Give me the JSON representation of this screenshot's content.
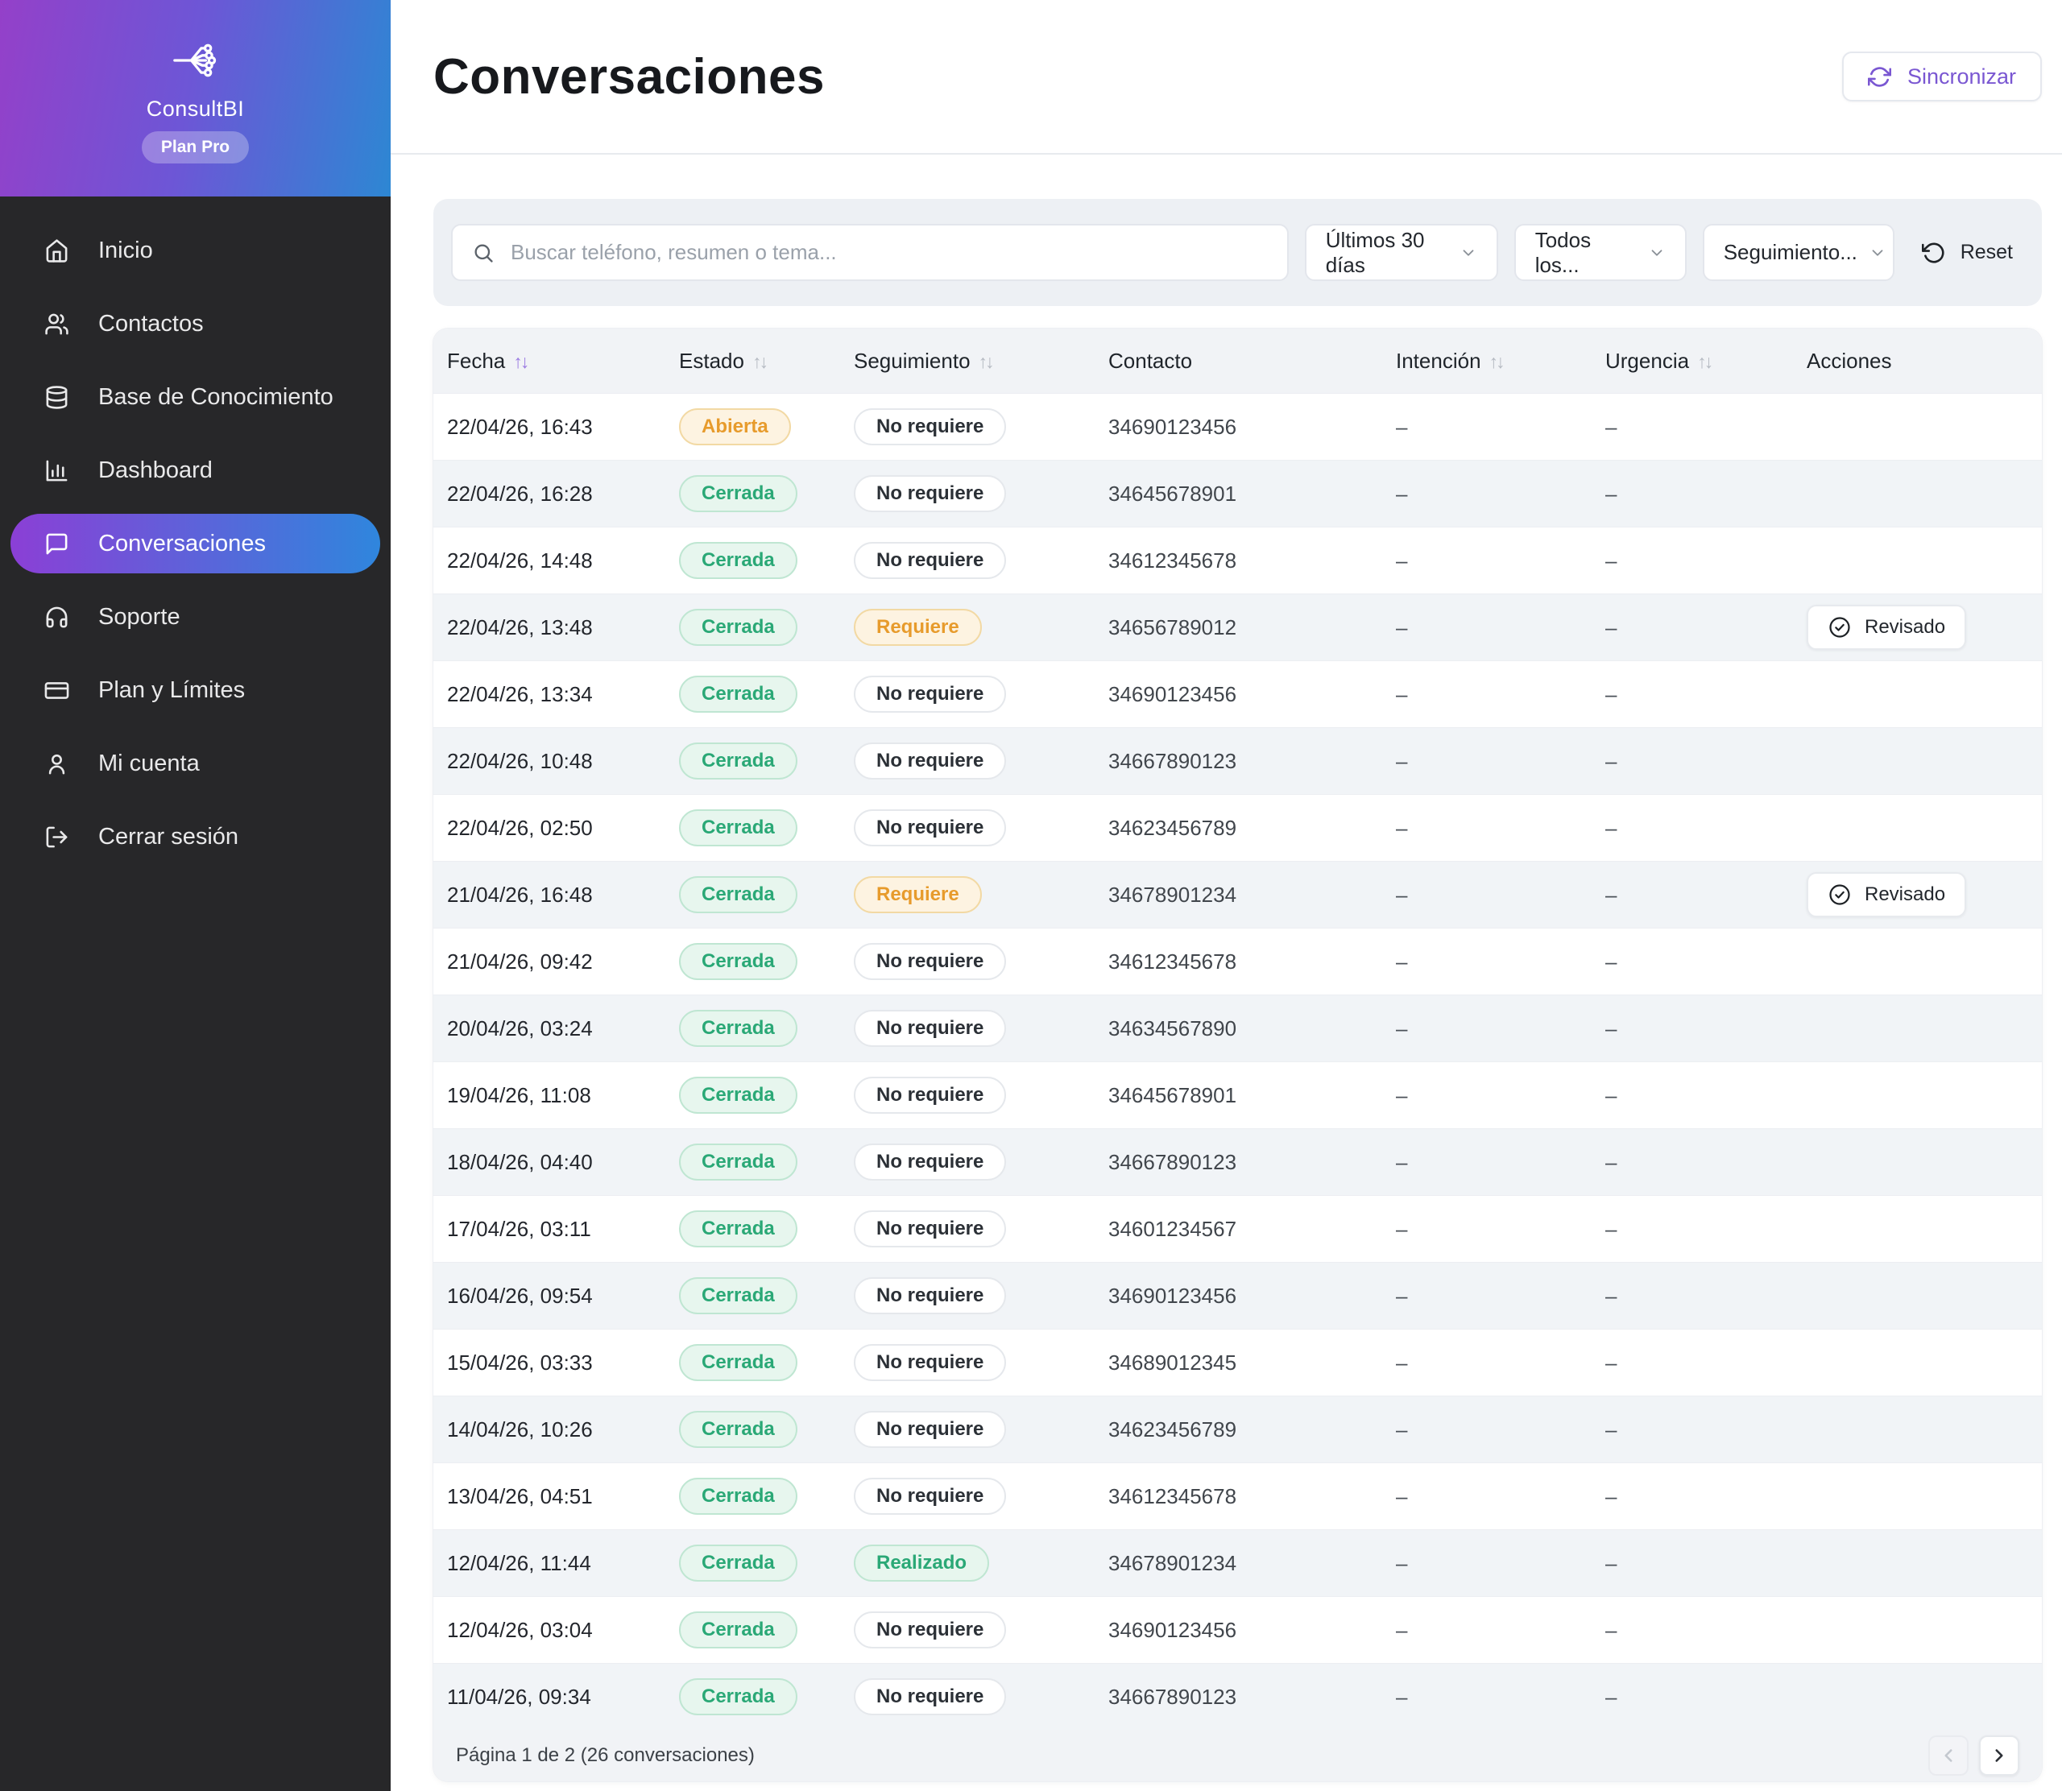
{
  "sidebar": {
    "brand": "ConsultBI",
    "plan_badge": "Plan Pro",
    "items": [
      {
        "label": "Inicio",
        "icon": "home",
        "active": false
      },
      {
        "label": "Contactos",
        "icon": "users",
        "active": false
      },
      {
        "label": "Base de Conocimiento",
        "icon": "database",
        "active": false
      },
      {
        "label": "Dashboard",
        "icon": "bar-chart",
        "active": false
      },
      {
        "label": "Conversaciones",
        "icon": "chat",
        "active": true
      },
      {
        "label": "Soporte",
        "icon": "headphones",
        "active": false
      },
      {
        "label": "Plan y Límites",
        "icon": "credit-card",
        "active": false
      },
      {
        "label": "Mi cuenta",
        "icon": "user",
        "active": false
      },
      {
        "label": "Cerrar sesión",
        "icon": "logout",
        "active": false
      }
    ]
  },
  "header": {
    "title": "Conversaciones",
    "sync_button": "Sincronizar"
  },
  "filters": {
    "search_placeholder": "Buscar teléfono, resumen o tema...",
    "date_filter": "Últimos 30 días",
    "status_filter": "Todos los...",
    "followup_filter": "Seguimiento...",
    "reset_label": "Reset"
  },
  "table": {
    "columns": [
      {
        "label": "Fecha",
        "sortable": true,
        "sort_active": true
      },
      {
        "label": "Estado",
        "sortable": true,
        "sort_active": false
      },
      {
        "label": "Seguimiento",
        "sortable": true,
        "sort_active": false
      },
      {
        "label": "Contacto",
        "sortable": false,
        "sort_active": false
      },
      {
        "label": "Intención",
        "sortable": true,
        "sort_active": false
      },
      {
        "label": "Urgencia",
        "sortable": true,
        "sort_active": false
      },
      {
        "label": "Acciones",
        "sortable": false,
        "sort_active": false
      }
    ],
    "badge_variants": {
      "Abierta": "warn",
      "Cerrada": "success",
      "Requiere": "warn",
      "No requiere": "neutral",
      "Realizado": "success"
    },
    "action_label": "Revisado",
    "empty_value": "–",
    "rows": [
      {
        "fecha": "22/04/26, 16:43",
        "estado": "Abierta",
        "seguimiento": "No requiere",
        "contacto": "34690123456",
        "intencion": "–",
        "urgencia": "–",
        "action": false
      },
      {
        "fecha": "22/04/26, 16:28",
        "estado": "Cerrada",
        "seguimiento": "No requiere",
        "contacto": "34645678901",
        "intencion": "–",
        "urgencia": "–",
        "action": false
      },
      {
        "fecha": "22/04/26, 14:48",
        "estado": "Cerrada",
        "seguimiento": "No requiere",
        "contacto": "34612345678",
        "intencion": "–",
        "urgencia": "–",
        "action": false
      },
      {
        "fecha": "22/04/26, 13:48",
        "estado": "Cerrada",
        "seguimiento": "Requiere",
        "contacto": "34656789012",
        "intencion": "–",
        "urgencia": "–",
        "action": true
      },
      {
        "fecha": "22/04/26, 13:34",
        "estado": "Cerrada",
        "seguimiento": "No requiere",
        "contacto": "34690123456",
        "intencion": "–",
        "urgencia": "–",
        "action": false
      },
      {
        "fecha": "22/04/26, 10:48",
        "estado": "Cerrada",
        "seguimiento": "No requiere",
        "contacto": "34667890123",
        "intencion": "–",
        "urgencia": "–",
        "action": false
      },
      {
        "fecha": "22/04/26, 02:50",
        "estado": "Cerrada",
        "seguimiento": "No requiere",
        "contacto": "34623456789",
        "intencion": "–",
        "urgencia": "–",
        "action": false
      },
      {
        "fecha": "21/04/26, 16:48",
        "estado": "Cerrada",
        "seguimiento": "Requiere",
        "contacto": "34678901234",
        "intencion": "–",
        "urgencia": "–",
        "action": true
      },
      {
        "fecha": "21/04/26, 09:42",
        "estado": "Cerrada",
        "seguimiento": "No requiere",
        "contacto": "34612345678",
        "intencion": "–",
        "urgencia": "–",
        "action": false
      },
      {
        "fecha": "20/04/26, 03:24",
        "estado": "Cerrada",
        "seguimiento": "No requiere",
        "contacto": "34634567890",
        "intencion": "–",
        "urgencia": "–",
        "action": false
      },
      {
        "fecha": "19/04/26, 11:08",
        "estado": "Cerrada",
        "seguimiento": "No requiere",
        "contacto": "34645678901",
        "intencion": "–",
        "urgencia": "–",
        "action": false
      },
      {
        "fecha": "18/04/26, 04:40",
        "estado": "Cerrada",
        "seguimiento": "No requiere",
        "contacto": "34667890123",
        "intencion": "–",
        "urgencia": "–",
        "action": false
      },
      {
        "fecha": "17/04/26, 03:11",
        "estado": "Cerrada",
        "seguimiento": "No requiere",
        "contacto": "34601234567",
        "intencion": "–",
        "urgencia": "–",
        "action": false
      },
      {
        "fecha": "16/04/26, 09:54",
        "estado": "Cerrada",
        "seguimiento": "No requiere",
        "contacto": "34690123456",
        "intencion": "–",
        "urgencia": "–",
        "action": false
      },
      {
        "fecha": "15/04/26, 03:33",
        "estado": "Cerrada",
        "seguimiento": "No requiere",
        "contacto": "34689012345",
        "intencion": "–",
        "urgencia": "–",
        "action": false
      },
      {
        "fecha": "14/04/26, 10:26",
        "estado": "Cerrada",
        "seguimiento": "No requiere",
        "contacto": "34623456789",
        "intencion": "–",
        "urgencia": "–",
        "action": false
      },
      {
        "fecha": "13/04/26, 04:51",
        "estado": "Cerrada",
        "seguimiento": "No requiere",
        "contacto": "34612345678",
        "intencion": "–",
        "urgencia": "–",
        "action": false
      },
      {
        "fecha": "12/04/26, 11:44",
        "estado": "Cerrada",
        "seguimiento": "Realizado",
        "contacto": "34678901234",
        "intencion": "–",
        "urgencia": "–",
        "action": false
      },
      {
        "fecha": "12/04/26, 03:04",
        "estado": "Cerrada",
        "seguimiento": "No requiere",
        "contacto": "34690123456",
        "intencion": "–",
        "urgencia": "–",
        "action": false
      },
      {
        "fecha": "11/04/26, 09:34",
        "estado": "Cerrada",
        "seguimiento": "No requiere",
        "contacto": "34667890123",
        "intencion": "–",
        "urgencia": "–",
        "action": false
      }
    ]
  },
  "pagination": {
    "summary": "Página 1 de 2 (26 conversaciones)",
    "prev_icon": "chevron-left",
    "next_icon": "chevron-right",
    "prev_disabled": true
  },
  "colors": {
    "sidebar_gradient_start": "#9440c9",
    "sidebar_gradient_end": "#2d87d3",
    "sidebar_bg": "#272729",
    "accent_purple": "#7a57d2",
    "badge_success_text": "#2aa876",
    "badge_warn_text": "#e79b2c",
    "filter_bg": "#edf0f4",
    "table_header_bg": "#f1f3f6",
    "row_alt_bg": "#f1f4f7"
  }
}
